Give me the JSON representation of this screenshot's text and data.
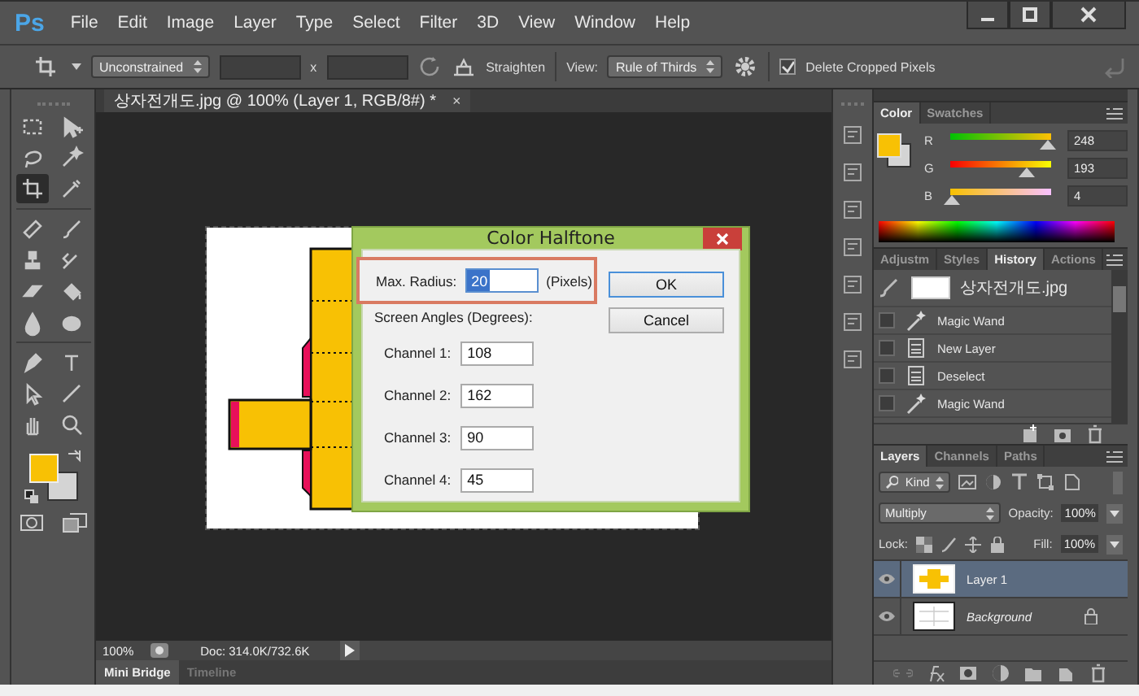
{
  "app": {
    "logo": "Ps"
  },
  "menu": [
    "File",
    "Edit",
    "Image",
    "Layer",
    "Type",
    "Select",
    "Filter",
    "3D",
    "View",
    "Window",
    "Help"
  ],
  "options_bar": {
    "aspect": "Unconstrained",
    "times": "x",
    "straighten": "Straighten",
    "view_label": "View:",
    "view": "Rule of Thirds",
    "delete_cropped": {
      "label": "Delete Cropped Pixels",
      "checked": true
    }
  },
  "document_tab": {
    "title": "상자전개도.jpg @ 100% (Layer 1, RGB/8#) *",
    "close": "×"
  },
  "tools": [
    {
      "selected": false
    },
    {
      "selected": false
    },
    {
      "selected": false
    },
    {
      "selected": false
    },
    {
      "selected": true
    },
    {
      "selected": false
    },
    {
      "selected": false
    },
    {
      "selected": false
    },
    {
      "selected": false
    },
    {
      "selected": false
    },
    {
      "selected": false
    },
    {
      "selected": false
    },
    {
      "selected": false
    },
    {
      "selected": false
    },
    {
      "selected": false
    },
    {
      "selected": false
    },
    {
      "selected": false
    },
    {
      "selected": false
    },
    {
      "selected": false
    },
    {
      "selected": false
    }
  ],
  "dialog": {
    "title": "Color Halftone",
    "max_radius": {
      "label": "Max. Radius:",
      "value": "20",
      "unit": "(Pixels)"
    },
    "angles_label": "Screen Angles (Degrees):",
    "channels": [
      {
        "label": "Channel 1:",
        "value": "108"
      },
      {
        "label": "Channel 2:",
        "value": "162"
      },
      {
        "label": "Channel 3:",
        "value": "90"
      },
      {
        "label": "Channel 4:",
        "value": "45"
      }
    ],
    "buttons": [
      {
        "label": "OK",
        "default": true
      },
      {
        "label": "Cancel",
        "default": false
      }
    ]
  },
  "status_bar": {
    "zoom": "100%",
    "doc": "Doc: 314.0K/732.6K"
  },
  "bottom_tabs": [
    {
      "label": "Mini Bridge",
      "selected": true
    },
    {
      "label": "Timeline",
      "selected": false
    }
  ],
  "color_panel": {
    "tabs": [
      {
        "label": "Color",
        "selected": true
      },
      {
        "label": "Swatches",
        "selected": false
      }
    ],
    "sliders": [
      {
        "label": "R",
        "level": 0.97,
        "value": "248"
      },
      {
        "label": "G",
        "level": 0.76,
        "value": "193"
      },
      {
        "label": "B",
        "level": 0.02,
        "value": "4"
      }
    ]
  },
  "history_panel": {
    "tabs": [
      {
        "label": "Adjustm",
        "selected": false
      },
      {
        "label": "Styles",
        "selected": false
      },
      {
        "label": "History",
        "selected": true
      },
      {
        "label": "Actions",
        "selected": false
      }
    ],
    "snapshot": "상자전개도.jpg",
    "items": [
      {
        "label": "Magic Wand",
        "kind": "wand"
      },
      {
        "label": "New Layer",
        "kind": "document"
      },
      {
        "label": "Deselect",
        "kind": "document"
      },
      {
        "label": "Magic Wand",
        "kind": "wand"
      }
    ]
  },
  "layers_panel": {
    "tabs": [
      {
        "label": "Layers",
        "selected": true
      },
      {
        "label": "Channels",
        "selected": false
      },
      {
        "label": "Paths",
        "selected": false
      }
    ],
    "filter": "Kind",
    "blend_mode": "Multiply",
    "opacity_label": "Opacity:",
    "opacity": "100%",
    "lock_label": "Lock:",
    "fill_label": "Fill:",
    "fill": "100%",
    "layers": [
      {
        "name": "Layer 1",
        "kind": "art",
        "selected": true,
        "visible": true,
        "locked": false
      },
      {
        "name": "Background",
        "kind": "background",
        "selected": false,
        "visible": true,
        "locked": true
      }
    ]
  }
}
